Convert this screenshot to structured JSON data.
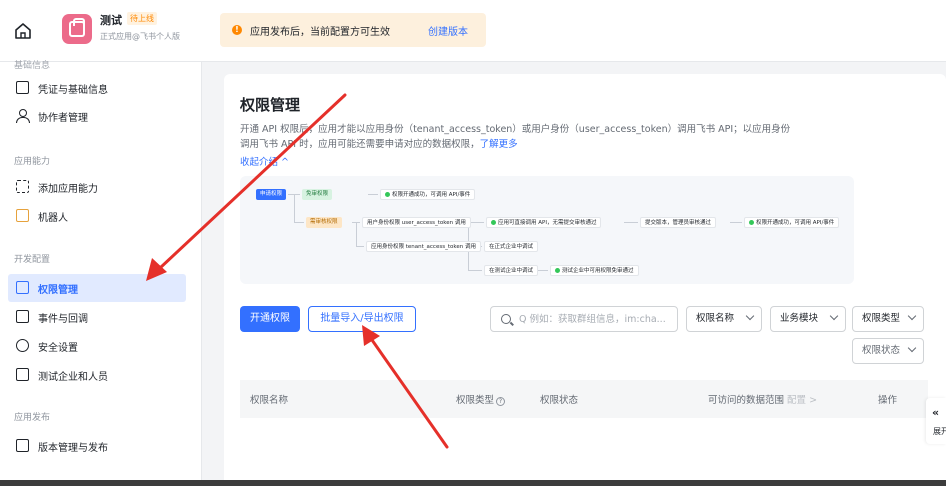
{
  "topbar": {
    "app_name": "测试",
    "app_badge": "待上线",
    "app_sub": "正式应用@飞书个人版",
    "notice_text": "应用发布后，当前配置方可生效",
    "notice_link": "创建版本"
  },
  "sidebar": {
    "cut_label": "基础信息",
    "items_top": [
      {
        "label": "凭证与基础信息"
      },
      {
        "label": "协作者管理"
      }
    ],
    "section_app_ability": "应用能力",
    "items_ability": [
      {
        "label": "添加应用能力"
      },
      {
        "label": "机器人"
      }
    ],
    "section_dev_config": "开发配置",
    "items_dev": [
      {
        "label": "权限管理"
      },
      {
        "label": "事件与回调"
      },
      {
        "label": "安全设置"
      },
      {
        "label": "测试企业和人员"
      }
    ],
    "section_publish": "应用发布",
    "items_publish": [
      {
        "label": "版本管理与发布"
      }
    ]
  },
  "main": {
    "title": "权限管理",
    "desc_line1": "开通 API 权限后，应用才能以应用身份（tenant_access_token）或用户身份（user_access_token）调用飞书 API；以应用身份",
    "desc_line2": "调用飞书 API 时，应用可能还需要申请对应的数据权限，",
    "desc_link": "了解更多",
    "collapse_label": "收起介绍 ^",
    "flow": {
      "start": "申请权限",
      "no_review": "免审权限",
      "no_review_result": "权限开通成功，可调用 API/事件",
      "need_review": "需审核权限",
      "user_identity": "用户身份权限 user_access_token 调用",
      "user_result": "应用可直接调用 API，无需提交审核通过",
      "submit_version": "提交版本，管理员审核通过",
      "final_result": "权限开通成功，可调用 API/事件",
      "app_identity": "应用身份权限 tenant_access_token 调用",
      "official_tenant": "在正式企业中调试",
      "test_tenant": "在测试企业中调试",
      "test_result": "测试企业中可用权限免审通过"
    },
    "btn_enable": "开通权限",
    "btn_batch": "批量导入/导出权限",
    "search_placeholder": "Q 例如：获取群组信息，im:cha...",
    "filters": [
      "权限名称",
      "业务模块",
      "权限类型",
      "权限状态"
    ],
    "table_headers": {
      "name": "权限名称",
      "type": "权限类型",
      "status": "权限状态",
      "scope": "可访问的数据范围",
      "scope_config": "配置 >",
      "action": "操作"
    }
  },
  "expand": {
    "chevron": "«",
    "label": "展开"
  },
  "colors": {
    "accent": "#3370ff",
    "notice_bg": "#fdf0dd",
    "arrow": "#e5302a"
  }
}
